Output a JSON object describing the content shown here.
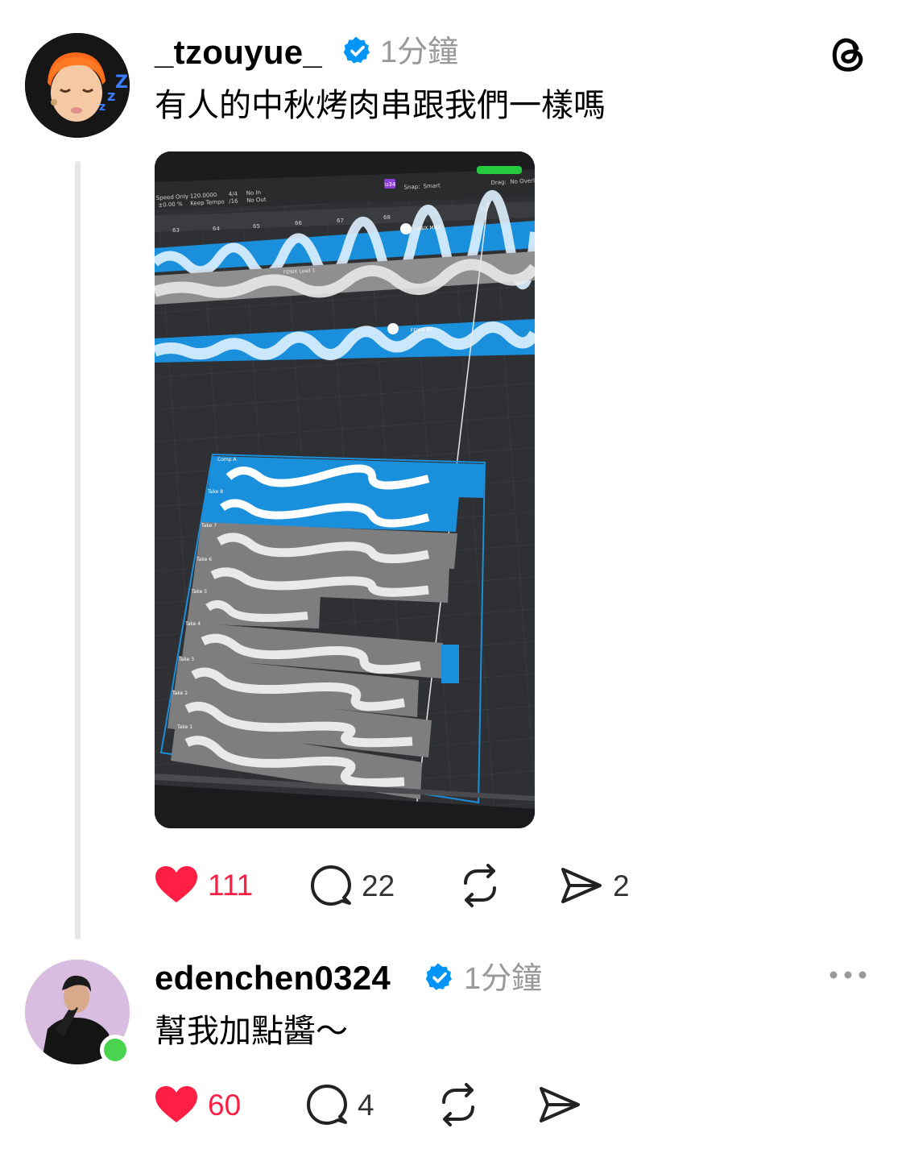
{
  "post": {
    "username": "_tzouyue_",
    "time": "1分鐘",
    "text": "有人的中秋烤肉串跟我們一樣嗎",
    "likes": "111",
    "comments": "22",
    "shares": "2",
    "media": {
      "toolbar": {
        "mode": "Speed Only",
        "tempo": "120.0000",
        "tempo_mode": "Keep Tempo",
        "offset": "±0.00 %",
        "signature": "4/4",
        "division": "/16",
        "in": "No In",
        "out": "No Out",
        "badge": "u34",
        "snap_label": "Snap:",
        "snap_value": "Smart",
        "drag_label": "Drag:",
        "drag_value": "No Overl"
      },
      "ruler": [
        "63",
        "64",
        "65",
        "66",
        "67",
        "68",
        "69",
        "70"
      ],
      "regions": [
        "FENIX MMA",
        "FENIX Lead 1",
        "FENIX BV"
      ],
      "takes": [
        "Comp A",
        "Take 8",
        "Take 7",
        "Take 6",
        "Take 5",
        "Take 4",
        "Take 3",
        "Take 2",
        "Take 1"
      ]
    }
  },
  "reply": {
    "username": "edenchen0324",
    "time": "1分鐘",
    "text": "幫我加點醬～",
    "likes": "60",
    "comments": "4"
  },
  "colors": {
    "like": "#ff1f45",
    "verified": "#0095f6",
    "online": "#4ad34f",
    "region_blue": "#1a8fdc"
  },
  "icons": [
    "threads-logo",
    "verified-icon",
    "heart-icon",
    "comment-icon",
    "repost-icon",
    "share-icon",
    "more-icon"
  ]
}
